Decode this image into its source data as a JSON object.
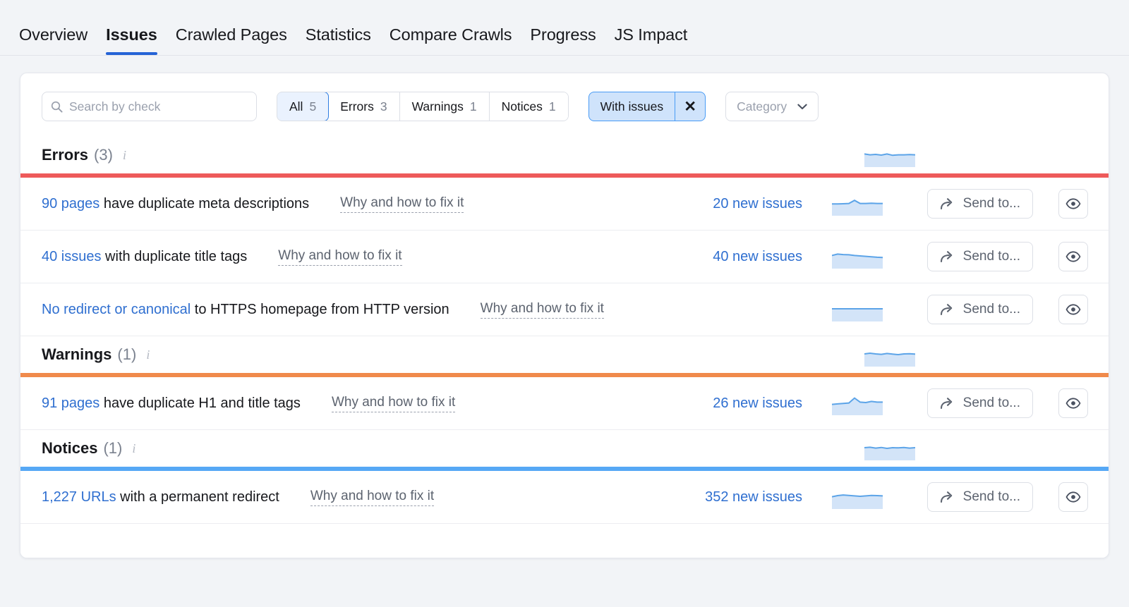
{
  "nav": {
    "tabs": [
      {
        "label": "Overview",
        "active": false
      },
      {
        "label": "Issues",
        "active": true
      },
      {
        "label": "Crawled Pages",
        "active": false
      },
      {
        "label": "Statistics",
        "active": false
      },
      {
        "label": "Compare Crawls",
        "active": false
      },
      {
        "label": "Progress",
        "active": false
      },
      {
        "label": "JS Impact",
        "active": false
      }
    ]
  },
  "toolbar": {
    "search": {
      "placeholder": "Search by check",
      "value": "",
      "icon": "search-icon"
    },
    "segments": [
      {
        "label": "All",
        "count": "5",
        "active": true
      },
      {
        "label": "Errors",
        "count": "3",
        "active": false
      },
      {
        "label": "Warnings",
        "count": "1",
        "active": false
      },
      {
        "label": "Notices",
        "count": "1",
        "active": false
      }
    ],
    "chip": {
      "label": "With issues",
      "remove_icon": "close-icon",
      "remove_label": "✕"
    },
    "category_dropdown": {
      "label": "Category",
      "icon": "chevron-down-icon"
    }
  },
  "colors": {
    "error": "#ee5a5a",
    "warning": "#f08a4b",
    "notice": "#56a8f5",
    "link": "#2f6fd0",
    "accent": "#2563d6",
    "spark_fill": "#d3e4f8",
    "spark_line": "#5ca4e8"
  },
  "groups": [
    {
      "name": "Errors",
      "count": "(3)",
      "info_icon": "info-icon",
      "divider_color": "#ee5a5a",
      "sparkline": [
        52,
        48,
        50,
        47,
        52,
        46,
        48,
        48,
        49,
        48
      ],
      "rows": [
        {
          "link_text": "90 pages",
          "rest_text": " have duplicate meta descriptions",
          "fix_link": "Why and how to fix it",
          "new_issues": "20 new issues",
          "sparkline": [
            46,
            46,
            47,
            48,
            62,
            48,
            48,
            49,
            48,
            48
          ],
          "send_label": "Send to...",
          "send_icon": "share-arrow-icon",
          "eye_icon": "eye-icon"
        },
        {
          "link_text": "40 issues",
          "rest_text": " with duplicate title tags",
          "fix_link": "Why and how to fix it",
          "new_issues": "40 new issues",
          "sparkline": [
            52,
            58,
            56,
            55,
            52,
            50,
            48,
            46,
            44,
            43
          ],
          "send_label": "Send to...",
          "send_icon": "share-arrow-icon",
          "eye_icon": "eye-icon"
        },
        {
          "link_text": "No redirect or canonical",
          "rest_text": " to HTTPS homepage from HTTP version",
          "fix_link": "Why and how to fix it",
          "new_issues": "",
          "sparkline": [
            50,
            50,
            50,
            50,
            50,
            50,
            50,
            50,
            50,
            50
          ],
          "send_label": "Send to...",
          "send_icon": "share-arrow-icon",
          "eye_icon": "eye-icon"
        }
      ]
    },
    {
      "name": "Warnings",
      "count": "(1)",
      "info_icon": "info-icon",
      "divider_color": "#f08a4b",
      "sparkline": [
        50,
        53,
        50,
        48,
        52,
        49,
        47,
        50,
        51,
        49
      ],
      "rows": [
        {
          "link_text": "91 pages",
          "rest_text": " have duplicate H1 and title tags",
          "fix_link": "Why and how to fix it",
          "new_issues": "26 new issues",
          "sparkline": [
            42,
            44,
            46,
            48,
            70,
            52,
            50,
            55,
            52,
            52
          ],
          "send_label": "Send to...",
          "send_icon": "share-arrow-icon",
          "eye_icon": "eye-icon"
        }
      ]
    },
    {
      "name": "Notices",
      "count": "(1)",
      "info_icon": "info-icon",
      "divider_color": "#56a8f5",
      "sparkline": [
        50,
        52,
        48,
        51,
        47,
        50,
        49,
        51,
        48,
        50
      ],
      "rows": [
        {
          "link_text": "1,227 URLs",
          "rest_text": " with a permanent redirect",
          "fix_link": "Why and how to fix it",
          "new_issues": "352 new issues",
          "sparkline": [
            48,
            53,
            56,
            54,
            52,
            50,
            52,
            54,
            53,
            52
          ],
          "send_label": "Send to...",
          "send_icon": "share-arrow-icon",
          "eye_icon": "eye-icon"
        }
      ]
    }
  ]
}
